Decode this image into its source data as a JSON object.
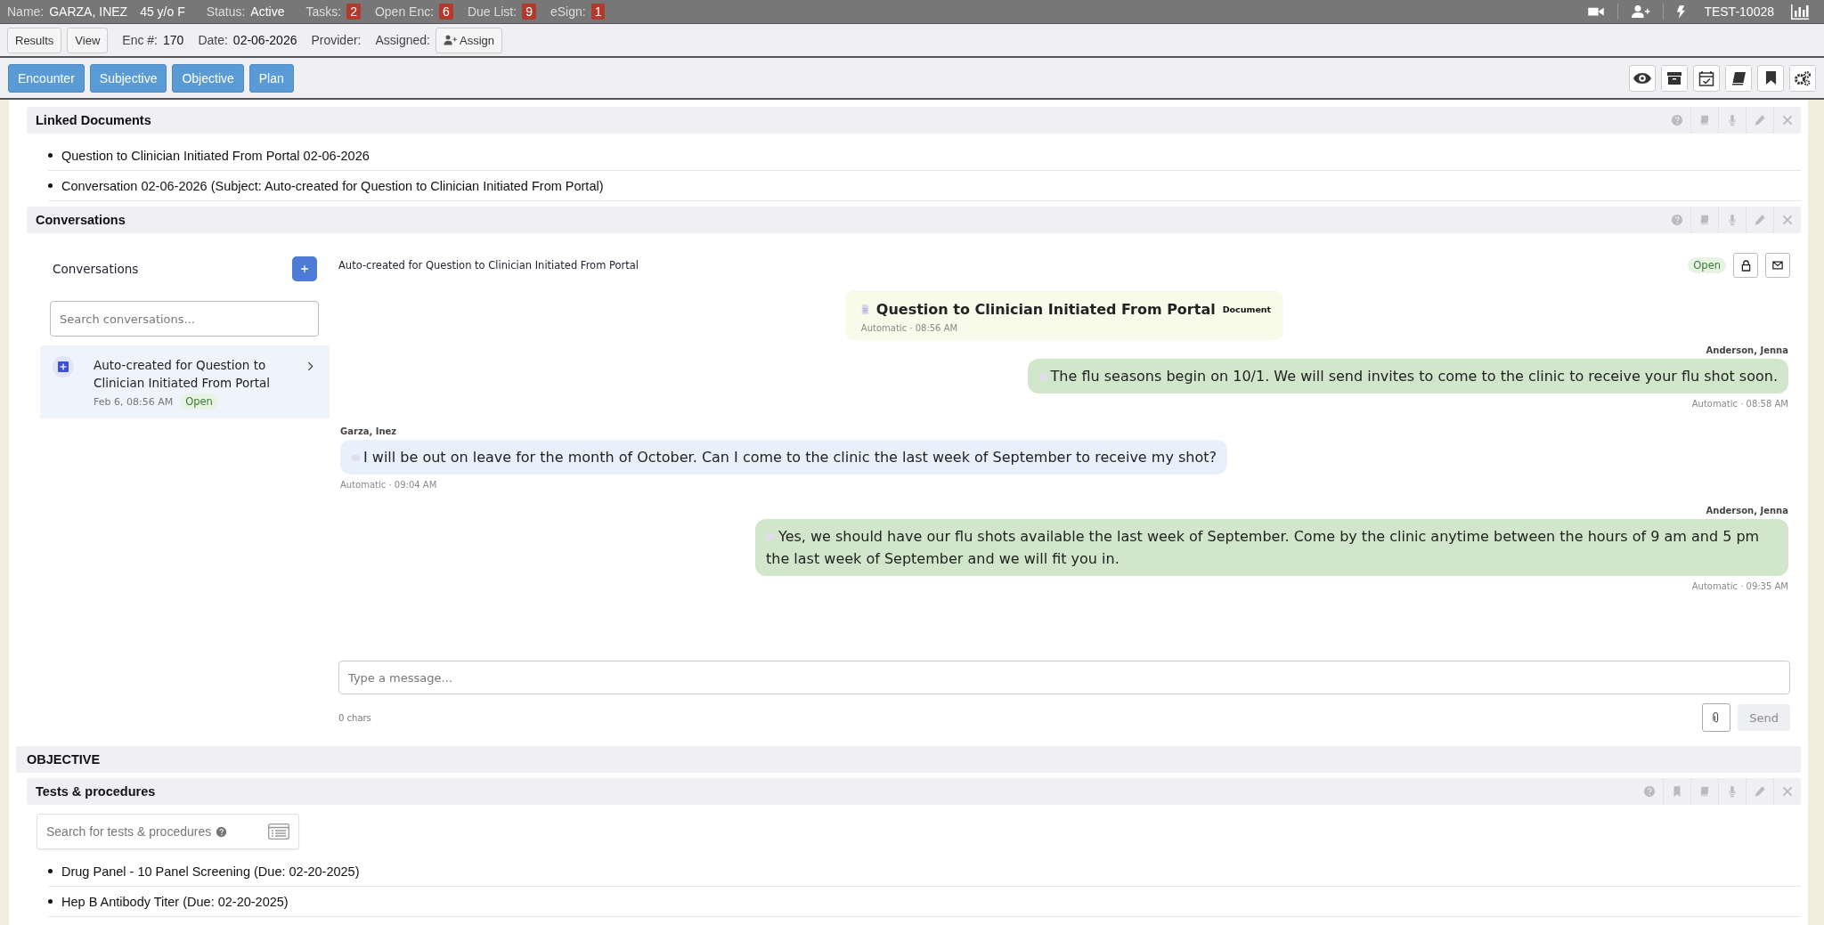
{
  "header": {
    "name_label": "Name:",
    "name": "GARZA, INEZ",
    "age_sex": "45 y/o F",
    "status_label": "Status:",
    "status": "Active",
    "counters": [
      {
        "label": "Tasks:",
        "count": "2"
      },
      {
        "label": "Open Enc:",
        "count": "6"
      },
      {
        "label": "Due List:",
        "count": "9"
      },
      {
        "label": "eSign:",
        "count": "1"
      }
    ],
    "patient_id": "TEST-10028"
  },
  "encounter_bar": {
    "buttons": [
      "Results",
      "View"
    ],
    "enc_label": "Enc #:",
    "enc": "170",
    "date_label": "Date:",
    "date": "02-06-2026",
    "provider_label": "Provider:",
    "assigned_label": "Assigned:",
    "assign_button": "Assign"
  },
  "nav_tabs": [
    "Encounter",
    "Subjective",
    "Objective",
    "Plan"
  ],
  "linked_documents": {
    "title": "Linked Documents",
    "items": [
      "Question to Clinician Initiated From Portal 02-06-2026",
      "Conversation 02-06-2026 (Subject: Auto-created for Question to Clinician Initiated From Portal)"
    ]
  },
  "conversations": {
    "title": "Conversations",
    "list_title": "Conversations",
    "search_placeholder": "Search conversations...",
    "items": [
      {
        "title": "Auto-created for Question to Clinician Initiated From Portal",
        "date": "Feb 6, 08:56 AM",
        "status": "Open",
        "selected": true
      }
    ],
    "thread": {
      "subject": "Auto-created for Question to Clinician Initiated From Portal",
      "status": "Open",
      "messages": [
        {
          "kind": "document",
          "title": "Question to Clinician Initiated From Portal",
          "tag": "Document",
          "meta": "Automatic · 08:56 AM"
        },
        {
          "kind": "outgoing",
          "author": "Anderson, Jenna",
          "text": "The flu seasons begin on 10/1. We will send invites to come to the clinic to receive your flu shot soon.",
          "meta": "Automatic · 08:58 AM"
        },
        {
          "kind": "incoming",
          "author": "Garza, Inez",
          "text": "I will be out on leave for the month of October. Can I come to the clinic the last week of September to receive my shot?",
          "meta": "Automatic · 09:04 AM"
        },
        {
          "kind": "outgoing",
          "author": "Anderson, Jenna",
          "text": "Yes, we should have our flu shots available the last week of September. Come by the clinic anytime between the hours of 9 am and 5 pm the last week of September and we will fit you in.",
          "meta": "Automatic · 09:35 AM"
        }
      ],
      "compose_placeholder": "Type a message...",
      "char_count": "0 chars",
      "send_label": "Send",
      "send_disabled": true
    }
  },
  "objective": {
    "title": "OBJECTIVE",
    "tests": {
      "title": "Tests & procedures",
      "search_placeholder": "Search for tests & procedures",
      "items": [
        "Drug Panel - 10 Panel Screening (Due: 02-20-2025)",
        "Hep B Antibody Titer (Due: 02-20-2025)"
      ]
    }
  }
}
